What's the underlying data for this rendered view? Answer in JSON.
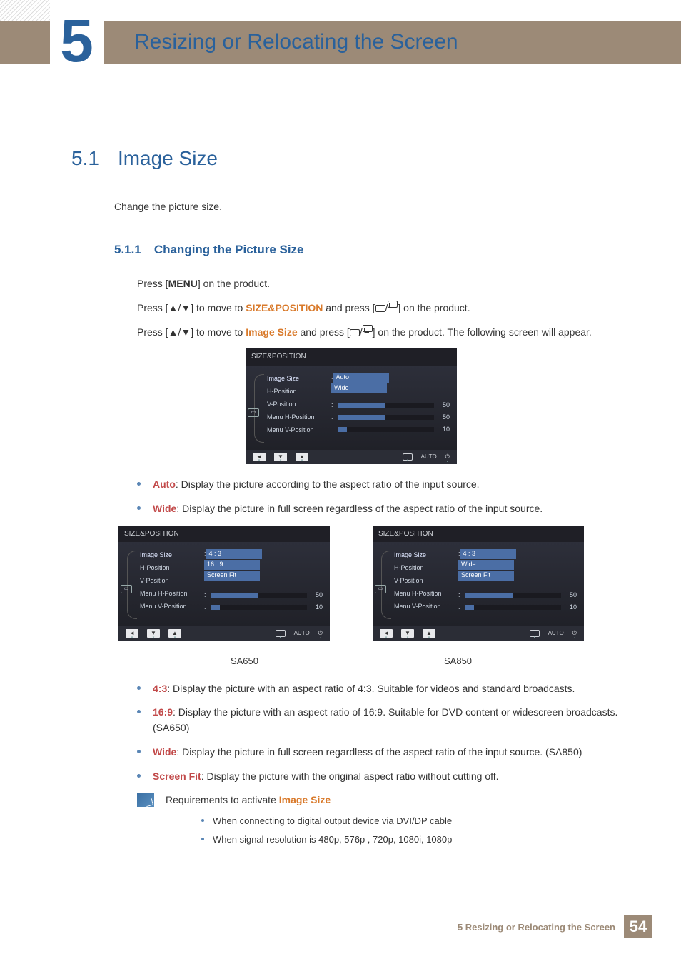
{
  "chapter": {
    "number": "5",
    "title": "Resizing or Relocating the Screen"
  },
  "section": {
    "number": "5.1",
    "title": "Image Size",
    "intro": "Change the picture size."
  },
  "subsection": {
    "number": "5.1.1",
    "title": "Changing the Picture Size"
  },
  "steps": {
    "s1_a": "Press [",
    "s1_menu": "MENU",
    "s1_b": "] on the product.",
    "s2_a": "Press [",
    "s2_arrows": "▲/▼",
    "s2_b": "] to move to ",
    "s2_term": "SIZE&POSITION",
    "s2_c": " and press [",
    "s2_d": "] on the product.",
    "s3_a": "Press [",
    "s3_arrows": "▲/▼",
    "s3_b": "] to move to ",
    "s3_term": "Image Size",
    "s3_c": " and press [",
    "s3_d": "] on the product. The following screen will appear."
  },
  "osd": {
    "title": "SIZE&POSITION",
    "menu": [
      "Image Size",
      "H-Position",
      "V-Position",
      "Menu H-Position",
      "Menu V-Position"
    ],
    "panelA": {
      "options": [
        "Auto",
        "Wide"
      ],
      "selected": "Auto",
      "sliders": [
        {
          "val": 50,
          "fill": 50
        },
        {
          "val": 50,
          "fill": 50
        },
        {
          "val": 10,
          "fill": 10
        }
      ]
    },
    "panelB": {
      "options": [
        "4 : 3",
        "16 : 9",
        "Screen Fit"
      ],
      "selected": "4 : 3",
      "sliders": [
        {
          "val": 50,
          "fill": 50
        },
        {
          "val": 10,
          "fill": 10
        }
      ]
    },
    "panelC": {
      "options": [
        "4 : 3",
        "Wide",
        "Screen Fit"
      ],
      "selected": "4 : 3",
      "sliders": [
        {
          "val": 50,
          "fill": 50
        },
        {
          "val": 10,
          "fill": 10
        }
      ]
    },
    "footer": {
      "auto": "AUTO"
    }
  },
  "bullets1": [
    {
      "term": "Auto",
      "desc": ": Display the picture according to the aspect ratio of the input source."
    },
    {
      "term": "Wide",
      "desc": ": Display the picture in full screen regardless of the aspect ratio of the input source."
    }
  ],
  "captions": {
    "left": "SA650",
    "right": "SA850"
  },
  "bullets2": [
    {
      "term": "4:3",
      "desc": ": Display the picture with an aspect ratio of 4:3. Suitable for videos and standard broadcasts."
    },
    {
      "term": "16:9",
      "desc": ": Display the picture with an aspect ratio of 16:9. Suitable for DVD content or widescreen broadcasts. (SA650)"
    },
    {
      "term": "Wide",
      "desc": ": Display the picture in full screen regardless of the aspect ratio of the input source. (SA850)"
    },
    {
      "term": "Screen Fit",
      "desc": ": Display the picture with the original aspect ratio without cutting off."
    }
  ],
  "note": {
    "lead_a": "Requirements to activate ",
    "lead_term": "Image Size",
    "items": [
      "When connecting to digital output device via DVI/DP cable",
      "When signal resolution is 480p, 576p , 720p, 1080i, 1080p"
    ]
  },
  "footer": {
    "text": "5 Resizing or Relocating the Screen",
    "page": "54"
  }
}
